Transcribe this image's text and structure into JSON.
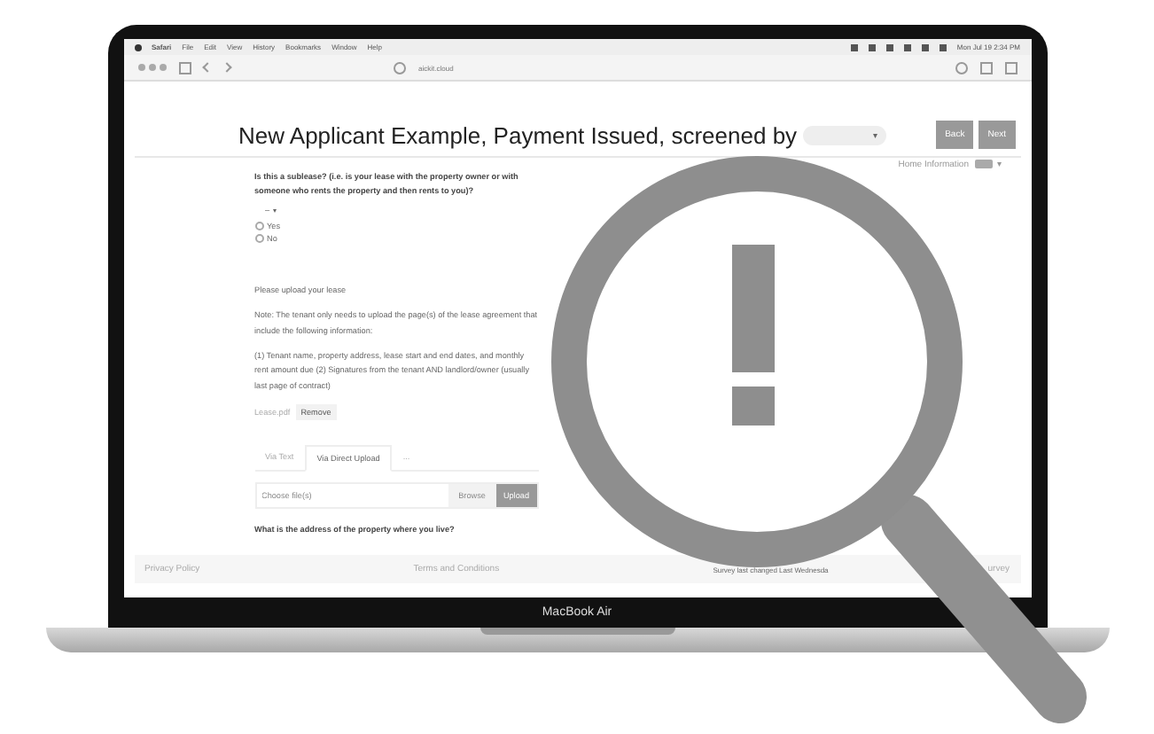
{
  "menu_bar": {
    "items": [
      "Safari",
      "File",
      "Edit",
      "View",
      "History",
      "Bookmarks",
      "Window",
      "Help"
    ],
    "clock": "Mon Jul 19 2:34 PM"
  },
  "browser": {
    "url": "aickit.cloud"
  },
  "page": {
    "title": "New Applicant Example, Payment Issued, screened by",
    "title_caret": "▾",
    "buttons": [
      "Back",
      "Next"
    ],
    "section": "Home Information",
    "section_caret": "▾",
    "question_1": "Is this a sublease? (i.e. is your lease with the property owner or with someone who rents the property and then rents to you)?",
    "select_value": "–",
    "options": [
      {
        "label": "Yes",
        "selected": false
      },
      {
        "label": "No",
        "selected": false
      }
    ],
    "upload_prompt": "Please upload your lease",
    "note": "Note: The tenant only needs to upload the page(s) of the lease agreement that include the following information:",
    "requirements": "(1) Tenant name, property address, lease start and end dates, and monthly rent amount due  (2) Signatures from the tenant AND landlord/owner (usually last page of contract)",
    "file_name": "Lease.pdf",
    "remove_button": "Remove",
    "tabs": [
      {
        "label": "Via Text",
        "selected": false
      },
      {
        "label": "Via Direct Upload",
        "selected": true
      },
      {
        "label": "...",
        "selected": false
      }
    ],
    "file_placeholder": "Choose file(s)",
    "browse_button": "Browse",
    "upload_button": "Upload",
    "question_2": "What is the address of the property where you live?"
  },
  "footer": {
    "privacy": "Privacy Policy",
    "terms": "Terms and Conditions",
    "changed": "Survey last changed Last Wednesda",
    "survey": "urvey"
  },
  "laptop_label": "MacBook Air"
}
